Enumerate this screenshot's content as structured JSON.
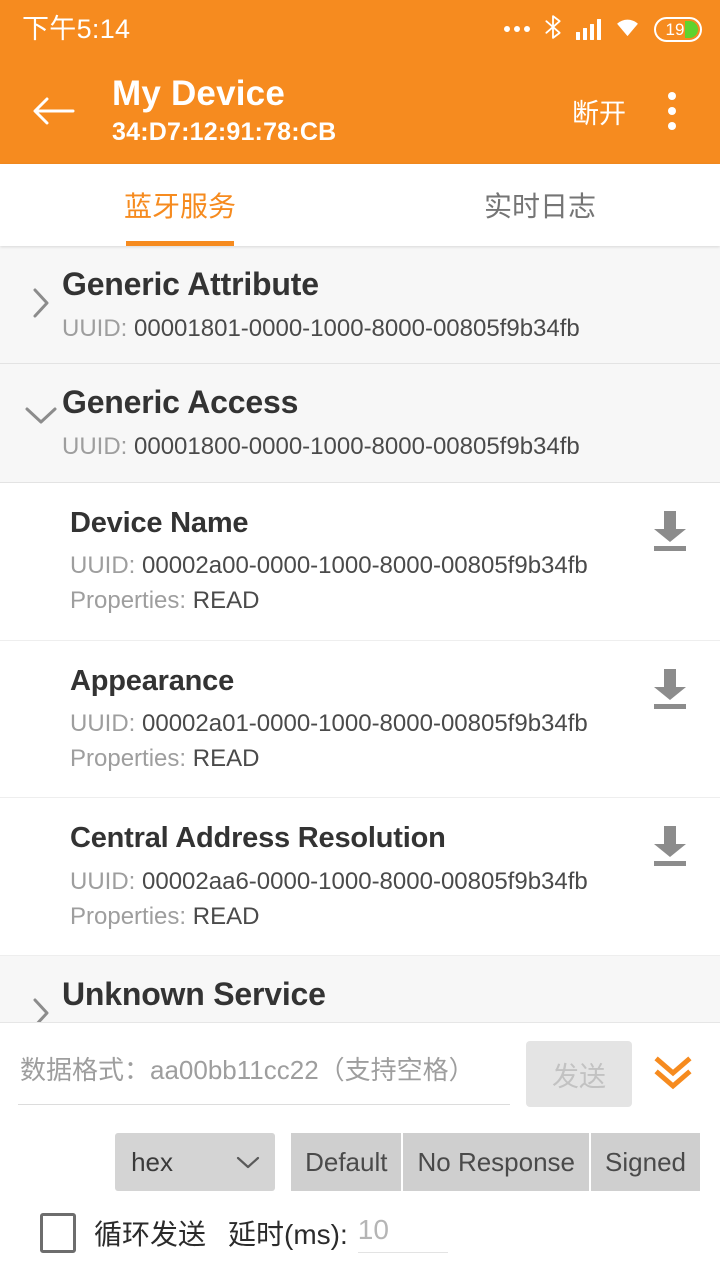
{
  "statusbar": {
    "time": "下午5:14",
    "battery_level": "19",
    "icons": [
      "more-dots-icon",
      "bluetooth-icon",
      "cellular-signal-icon",
      "wifi-icon",
      "battery-icon"
    ]
  },
  "appbar": {
    "back_icon": "arrow-left-icon",
    "title": "My Device",
    "subtitle": "34:D7:12:91:78:CB",
    "action_label": "断开",
    "overflow_icon": "more-vert-icon",
    "accent_color": "#F68B1F"
  },
  "tabs": [
    {
      "label": "蓝牙服务",
      "active": true
    },
    {
      "label": "实时日志",
      "active": false
    }
  ],
  "labels": {
    "uuid_prefix": "UUID:",
    "properties_prefix": "Properties:"
  },
  "services": [
    {
      "name": "Generic Attribute",
      "uuid": "00001801-0000-1000-8000-00805f9b34fb",
      "expanded": false,
      "chevron": "chevron-right-icon",
      "characteristics": []
    },
    {
      "name": "Generic Access",
      "uuid": "00001800-0000-1000-8000-00805f9b34fb",
      "expanded": true,
      "chevron": "chevron-down-icon",
      "characteristics": [
        {
          "name": "Device Name",
          "uuid": "00002a00-0000-1000-8000-00805f9b34fb",
          "properties": "READ",
          "action_icon": "download-icon"
        },
        {
          "name": "Appearance",
          "uuid": "00002a01-0000-1000-8000-00805f9b34fb",
          "properties": "READ",
          "action_icon": "download-icon"
        },
        {
          "name": "Central Address Resolution",
          "uuid": "00002aa6-0000-1000-8000-00805f9b34fb",
          "properties": "READ",
          "action_icon": "download-icon"
        }
      ]
    },
    {
      "name": "Unknown Service",
      "uuid": "",
      "expanded": false,
      "chevron": "chevron-right-icon",
      "characteristics": []
    }
  ],
  "bottom_panel": {
    "data_input_placeholder": "数据格式：aa00bb11cc22（支持空格）",
    "data_input_value": "",
    "send_label": "发送",
    "send_enabled": false,
    "expand_icon": "double-chevron-down-icon",
    "expand_icon_color": "#F68B1F",
    "format_select": {
      "value": "hex",
      "chevron": "chevron-down-icon"
    },
    "write_modes": [
      {
        "label": "Default",
        "selected": false
      },
      {
        "label": "No Response",
        "selected": false
      },
      {
        "label": "Signed",
        "selected": false
      }
    ],
    "loop_send": {
      "label": "循环发送",
      "checked": false
    },
    "delay": {
      "label": "延时(ms):",
      "placeholder": "10",
      "value": ""
    }
  }
}
